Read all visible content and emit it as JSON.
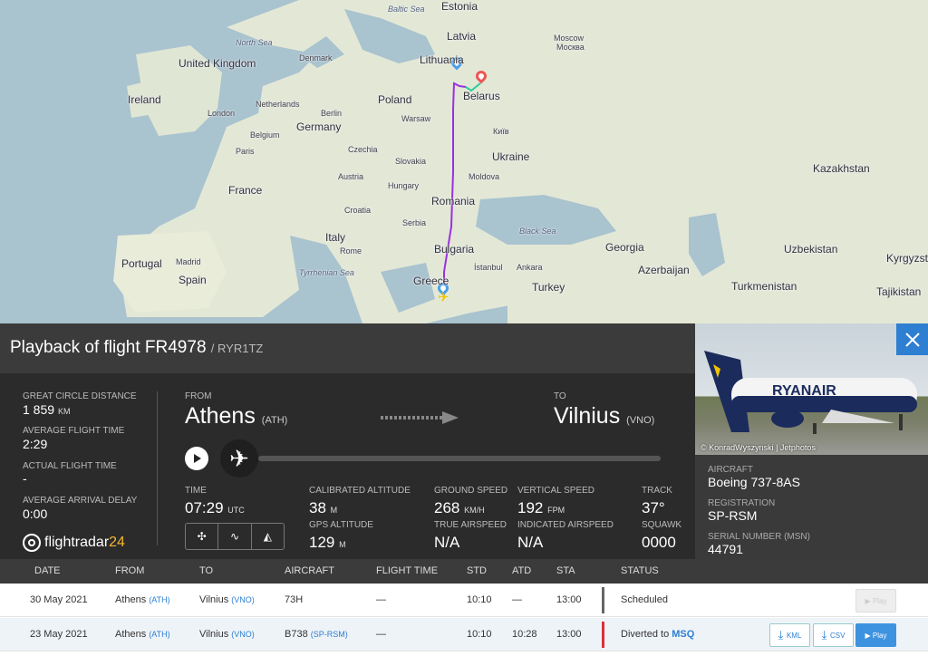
{
  "map": {
    "labels": [
      {
        "id": "baltic-sea",
        "text": "Baltic Sea",
        "cls": "sea"
      },
      {
        "id": "estonia",
        "text": "Estonia",
        "cls": ""
      },
      {
        "id": "north-sea",
        "text": "North Sea",
        "cls": "sea"
      },
      {
        "id": "latvia",
        "text": "Latvia",
        "cls": ""
      },
      {
        "id": "denmark",
        "text": "Denmark",
        "cls": "small"
      },
      {
        "id": "moscow",
        "text": "Moscow",
        "cls": "small"
      },
      {
        "id": "moscow-ru",
        "text": "Москва",
        "cls": "small"
      },
      {
        "id": "united-kingdom",
        "text": "United Kingdom",
        "cls": ""
      },
      {
        "id": "lithuania",
        "text": "Lithuania",
        "cls": ""
      },
      {
        "id": "ireland",
        "text": "Ireland",
        "cls": ""
      },
      {
        "id": "belarus",
        "text": "Belarus",
        "cls": ""
      },
      {
        "id": "netherlands",
        "text": "Netherlands",
        "cls": "small"
      },
      {
        "id": "poland",
        "text": "Poland",
        "cls": ""
      },
      {
        "id": "london",
        "text": "London",
        "cls": "small"
      },
      {
        "id": "berlin",
        "text": "Berlin",
        "cls": "small"
      },
      {
        "id": "warsaw",
        "text": "Warsaw",
        "cls": "small"
      },
      {
        "id": "belgium",
        "text": "Belgium",
        "cls": "small"
      },
      {
        "id": "germany",
        "text": "Germany",
        "cls": ""
      },
      {
        "id": "kyiv",
        "text": "Київ",
        "cls": "small"
      },
      {
        "id": "paris",
        "text": "Paris",
        "cls": "small"
      },
      {
        "id": "czechia",
        "text": "Czechia",
        "cls": "small"
      },
      {
        "id": "ukraine",
        "text": "Ukraine",
        "cls": ""
      },
      {
        "id": "slovakia",
        "text": "Slovakia",
        "cls": "small"
      },
      {
        "id": "kazakhstan",
        "text": "Kazakhstan",
        "cls": ""
      },
      {
        "id": "france",
        "text": "France",
        "cls": ""
      },
      {
        "id": "austria",
        "text": "Austria",
        "cls": "small"
      },
      {
        "id": "hungary",
        "text": "Hungary",
        "cls": "small"
      },
      {
        "id": "moldova",
        "text": "Moldova",
        "cls": "small"
      },
      {
        "id": "croatia",
        "text": "Croatia",
        "cls": "small"
      },
      {
        "id": "romania",
        "text": "Romania",
        "cls": ""
      },
      {
        "id": "serbia",
        "text": "Serbia",
        "cls": "small"
      },
      {
        "id": "black-sea",
        "text": "Black Sea",
        "cls": "sea"
      },
      {
        "id": "italy",
        "text": "Italy",
        "cls": ""
      },
      {
        "id": "georgia",
        "text": "Georgia",
        "cls": ""
      },
      {
        "id": "uzbekistan",
        "text": "Uzbekistan",
        "cls": ""
      },
      {
        "id": "kyrgyzsta",
        "text": "Kyrgyzsta",
        "cls": ""
      },
      {
        "id": "portugal",
        "text": "Portugal",
        "cls": ""
      },
      {
        "id": "madrid",
        "text": "Madrid",
        "cls": "small"
      },
      {
        "id": "rome",
        "text": "Rome",
        "cls": "small"
      },
      {
        "id": "bulgaria",
        "text": "Bulgaria",
        "cls": ""
      },
      {
        "id": "istanbul",
        "text": "İstanbul",
        "cls": "small"
      },
      {
        "id": "ankara",
        "text": "Ankara",
        "cls": "small"
      },
      {
        "id": "azerbaijan",
        "text": "Azerbaijan",
        "cls": ""
      },
      {
        "id": "tyrrhenian-sea",
        "text": "Tyrrhenian Sea",
        "cls": "sea"
      },
      {
        "id": "spain",
        "text": "Spain",
        "cls": ""
      },
      {
        "id": "greece",
        "text": "Greece",
        "cls": ""
      },
      {
        "id": "turkey",
        "text": "Turkey",
        "cls": ""
      },
      {
        "id": "turkmenistan",
        "text": "Turkmenistan",
        "cls": ""
      },
      {
        "id": "tajikistan",
        "text": "Tajikistan",
        "cls": ""
      }
    ]
  },
  "header": {
    "title": "Playback of flight FR4978",
    "callsign": "/ RYR1TZ"
  },
  "stats": {
    "gcd_label": "GREAT CIRCLE DISTANCE",
    "gcd_value": "1 859",
    "gcd_unit": "KM",
    "aft_label": "AVERAGE FLIGHT TIME",
    "aft_value": "2:29",
    "actual_label": "ACTUAL FLIGHT TIME",
    "actual_value": "-",
    "delay_label": "AVERAGE ARRIVAL DELAY",
    "delay_value": "0:00",
    "logo_text": "flightradar",
    "logo_num": "24"
  },
  "route": {
    "from_label": "FROM",
    "from_city": "Athens",
    "from_code": "(ATH)",
    "to_label": "TO",
    "to_city": "Vilnius",
    "to_code": "(VNO)"
  },
  "telemetry": {
    "time_label": "TIME",
    "time_value": "07:29",
    "time_unit": "UTC",
    "cal_alt_label": "CALIBRATED ALTITUDE",
    "cal_alt_value": "38",
    "cal_alt_unit": "M",
    "gps_alt_label": "GPS ALTITUDE",
    "gps_alt_value": "129",
    "gps_alt_unit": "M",
    "gs_label": "GROUND SPEED",
    "gs_value": "268",
    "gs_unit": "KM/H",
    "tas_label": "TRUE AIRSPEED",
    "tas_value": "N/A",
    "vs_label": "VERTICAL SPEED",
    "vs_value": "192",
    "vs_unit": "FPM",
    "ias_label": "INDICATED AIRSPEED",
    "ias_value": "N/A",
    "track_label": "TRACK",
    "track_value": "37°",
    "squawk_label": "SQUAWK",
    "squawk_value": "0000"
  },
  "aircraft": {
    "photo_credit": "© KonradWyszynski | Jetphotos",
    "livery_text": "RYANAIR",
    "type_label": "AIRCRAFT",
    "type_value": "Boeing 737-8AS",
    "reg_label": "REGISTRATION",
    "reg_value": "SP-RSM",
    "msn_label": "SERIAL NUMBER (MSN)",
    "msn_value": "44791"
  },
  "table": {
    "headers": [
      "DATE",
      "FROM",
      "TO",
      "AIRCRAFT",
      "FLIGHT TIME",
      "STD",
      "ATD",
      "STA",
      "STATUS"
    ],
    "rows": [
      {
        "date": "30 May 2021",
        "from": "Athens",
        "from_code": "(ATH)",
        "to": "Vilnius",
        "to_code": "(VNO)",
        "aircraft": "73H",
        "aircraft_reg": "",
        "flight_time": "—",
        "std": "10:10",
        "atd": "—",
        "sta": "13:00",
        "status": "Scheduled",
        "status_link": "",
        "status_color": "#666",
        "play": "Play",
        "kml": "",
        "csv": ""
      },
      {
        "date": "23 May 2021",
        "from": "Athens",
        "from_code": "(ATH)",
        "to": "Vilnius",
        "to_code": "(VNO)",
        "aircraft": "B738",
        "aircraft_reg": "(SP-RSM)",
        "flight_time": "—",
        "std": "10:10",
        "atd": "10:28",
        "sta": "13:00",
        "status": "Diverted to",
        "status_link": "MSQ",
        "status_color": "#d9303a",
        "play": "Play",
        "kml": "KML",
        "csv": "CSV"
      }
    ]
  },
  "colors": {
    "track": "#9b30e0",
    "track_end": "#2ecc9a",
    "accent": "#2e7fd1"
  }
}
